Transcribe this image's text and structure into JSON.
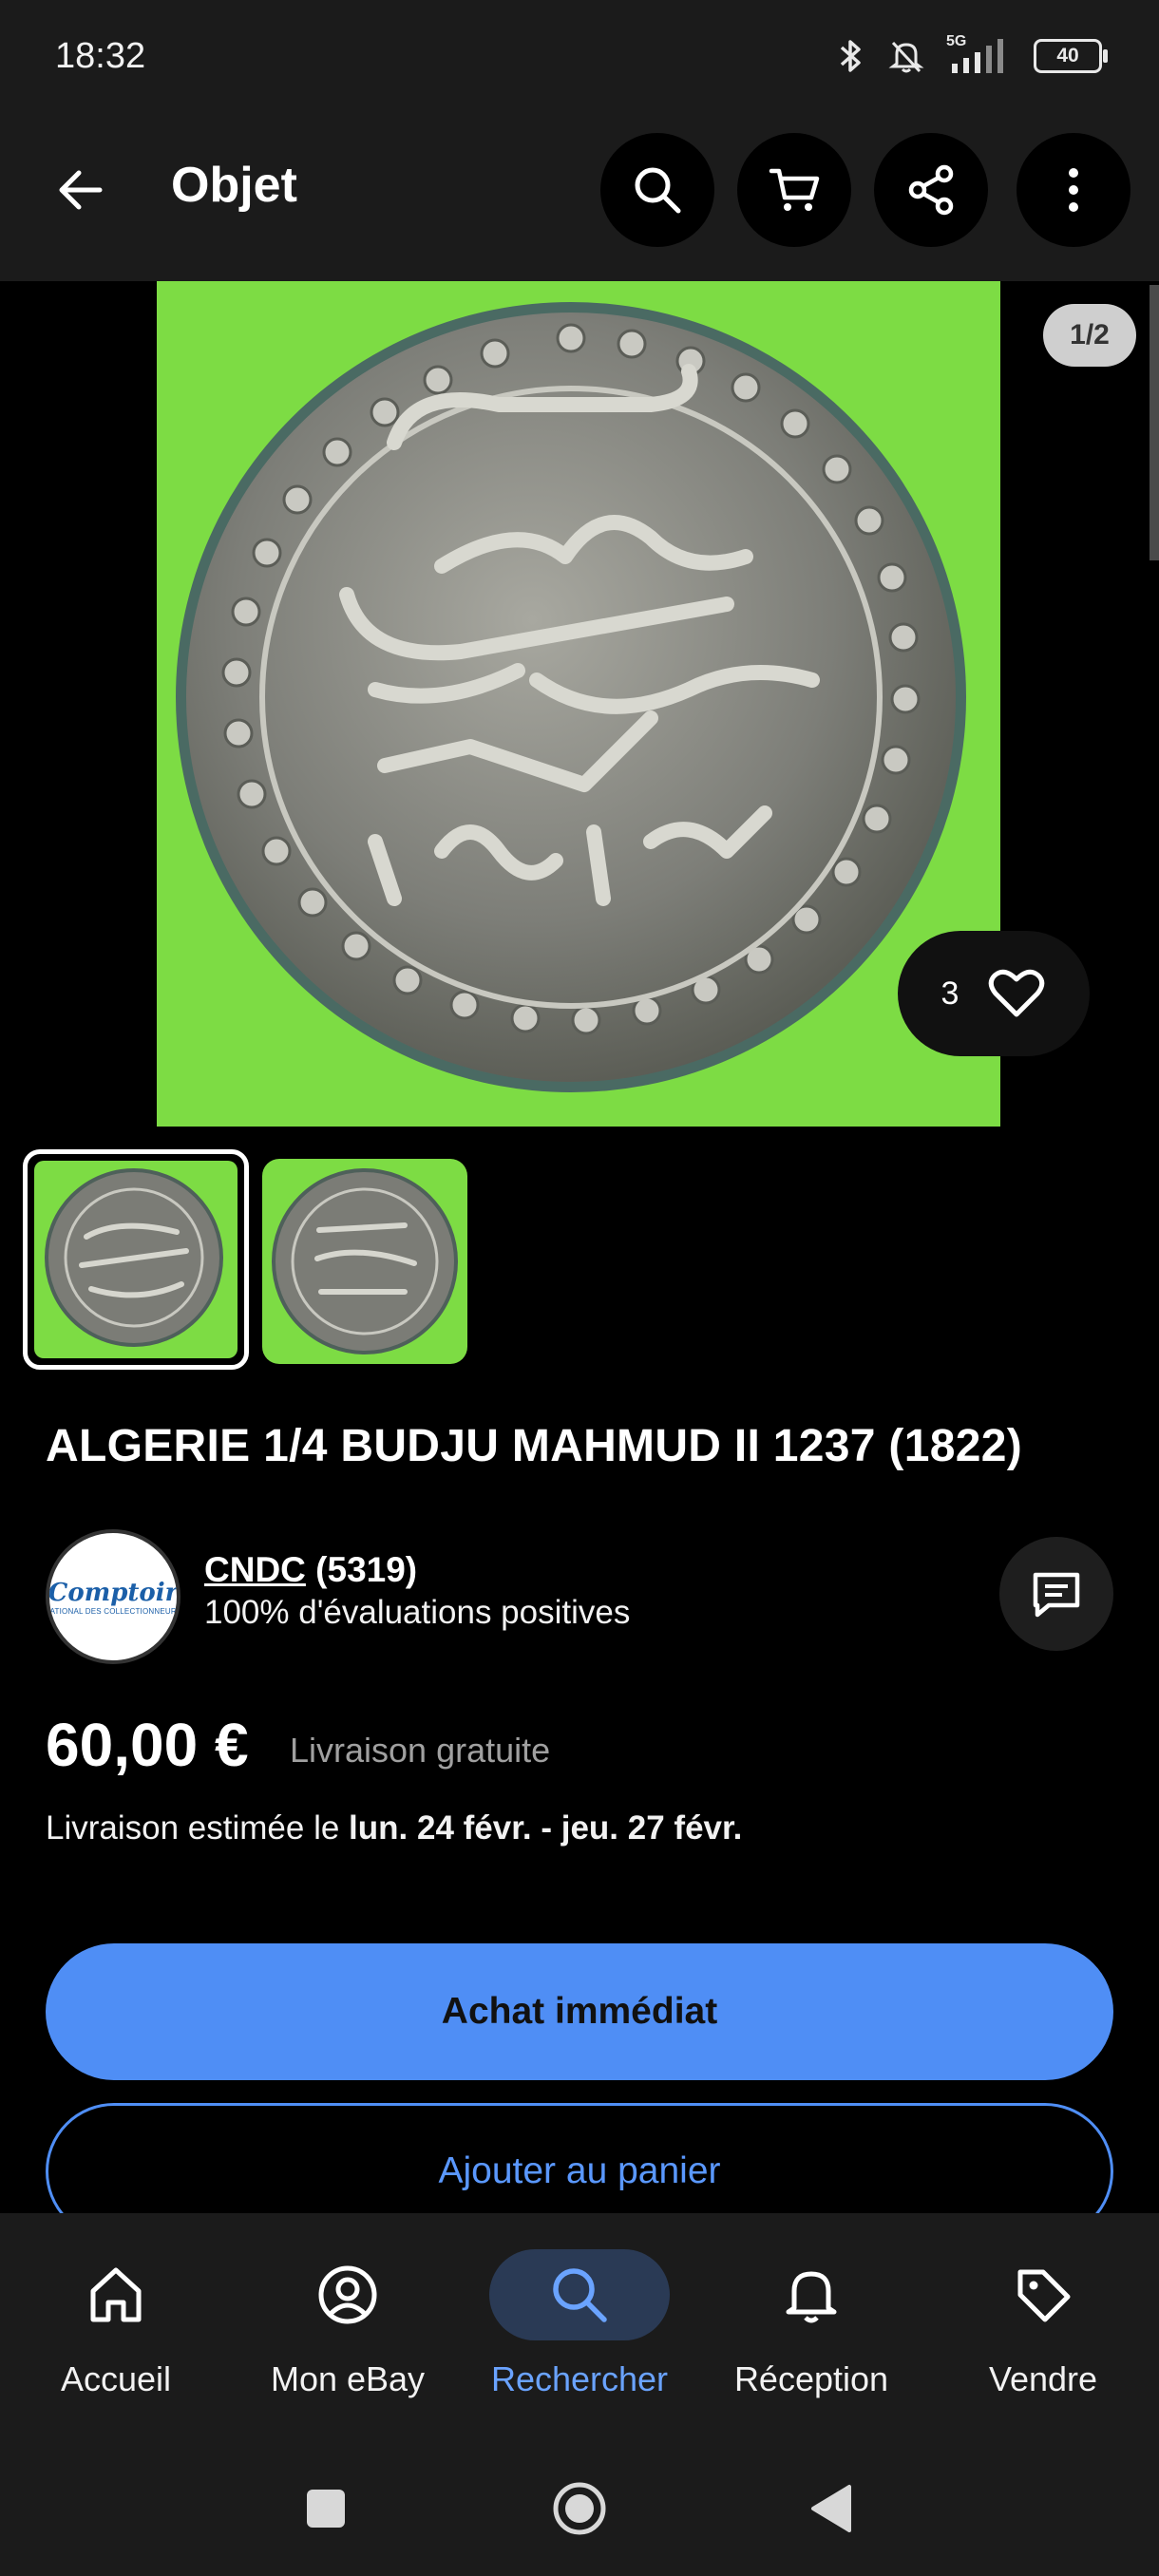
{
  "status_bar": {
    "time": "18:32",
    "network": "5G",
    "battery": "40"
  },
  "app_bar": {
    "title": "Objet",
    "icons": [
      "arrow-left-icon",
      "search-icon",
      "cart-icon",
      "share-icon",
      "more-vert-icon"
    ]
  },
  "gallery": {
    "counter": "1/2",
    "likes": "3"
  },
  "item": {
    "title": "ALGERIE 1/4 BUDJU MAHMUD II 1237 (1822)"
  },
  "seller": {
    "logo_text": "Comptoir",
    "logo_subtext": "NATIONAL DES COLLECTIONNEURS",
    "name": "CNDC",
    "count": "(5319)",
    "feedback": "100% d'évaluations positives"
  },
  "pricing": {
    "price": "60,00 €",
    "shipping": "Livraison gratuite",
    "delivery_prefix": "Livraison estimée le ",
    "delivery_dates": "lun. 24 févr. - jeu. 27 févr."
  },
  "actions": {
    "buy_now": "Achat immédiat",
    "add_to_cart": "Ajouter au panier"
  },
  "bottom_nav": {
    "items": [
      {
        "label": "Accueil",
        "icon": "home-icon"
      },
      {
        "label": "Mon eBay",
        "icon": "account-icon"
      },
      {
        "label": "Rechercher",
        "icon": "search-icon",
        "active": true
      },
      {
        "label": "Réception",
        "icon": "bell-icon"
      },
      {
        "label": "Vendre",
        "icon": "tag-icon"
      }
    ]
  },
  "colors": {
    "accent": "#4f8ef5",
    "photo_background": "#7ddc44",
    "active_nav": "#6aa3ff"
  }
}
